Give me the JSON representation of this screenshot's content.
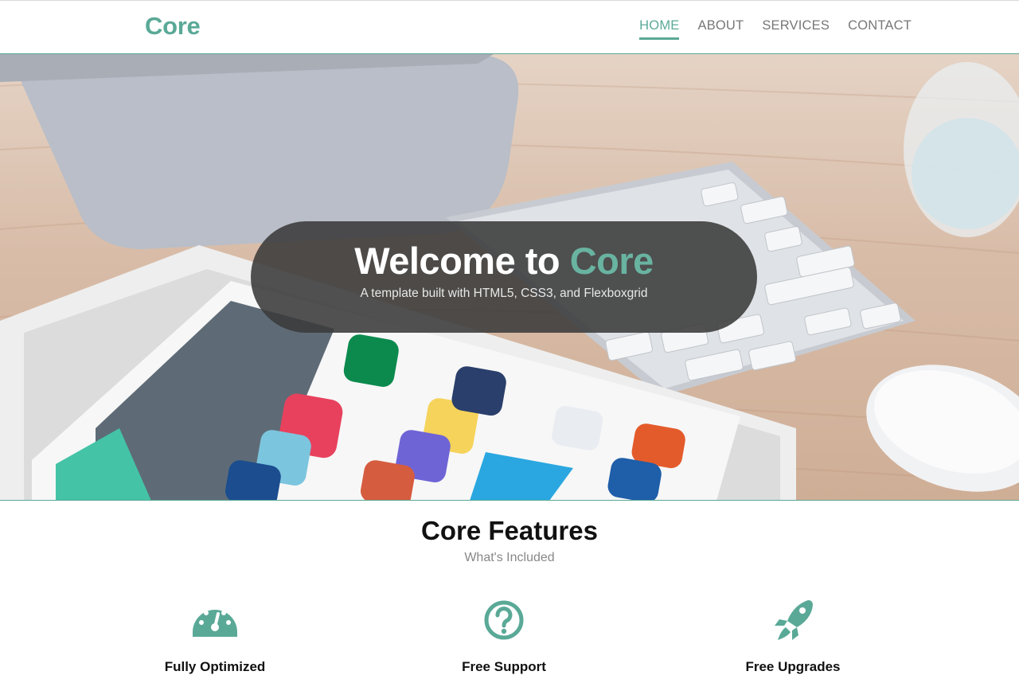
{
  "brand": {
    "name": "Core"
  },
  "nav": {
    "items": [
      {
        "label": "HOME",
        "active": true
      },
      {
        "label": "ABOUT",
        "active": false
      },
      {
        "label": "SERVICES",
        "active": false
      },
      {
        "label": "CONTACT",
        "active": false
      }
    ]
  },
  "hero": {
    "title_prefix": "Welcome to",
    "title_accent": "Core",
    "subtitle": "A template built with HTML5, CSS3, and Flexboxgrid"
  },
  "features": {
    "title": "Core Features",
    "subtitle": "What's Included",
    "items": [
      {
        "label": "Fully Optimized",
        "icon": "dashboard-gauge-icon"
      },
      {
        "label": "Free Support",
        "icon": "question-circle-icon"
      },
      {
        "label": "Free Upgrades",
        "icon": "rocket-icon"
      }
    ]
  },
  "colors": {
    "accent": "#5aa997",
    "text": "#111111",
    "muted": "#888888",
    "hero_overlay": "#3a3a3a"
  }
}
